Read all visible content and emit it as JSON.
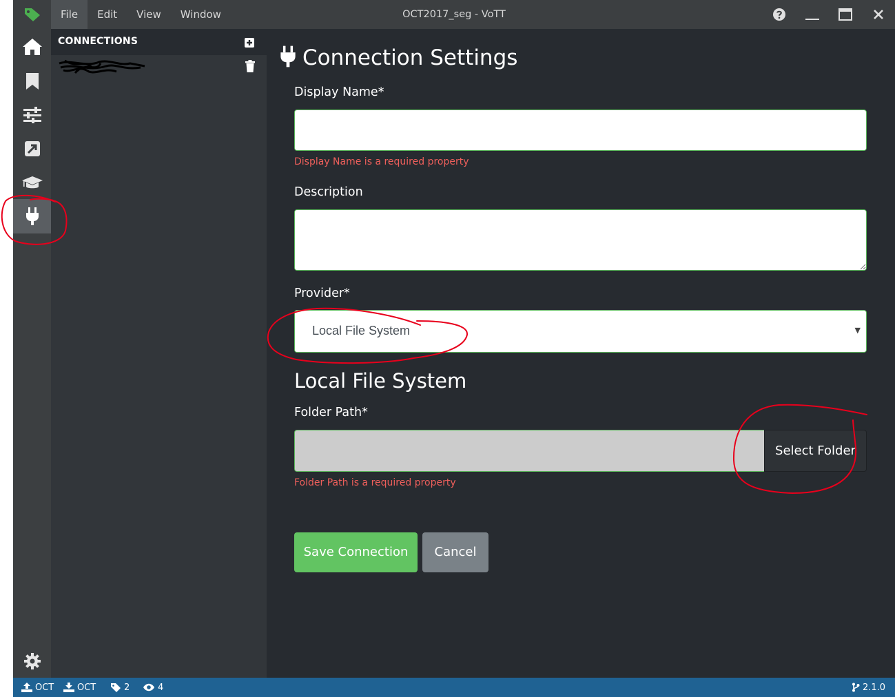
{
  "window": {
    "title": "OCT2017_seg - VoTT"
  },
  "menu": [
    {
      "label": "File",
      "active": true
    },
    {
      "label": "Edit",
      "active": false
    },
    {
      "label": "View",
      "active": false
    },
    {
      "label": "Window",
      "active": false
    }
  ],
  "iconbar": {
    "items": [
      "home-icon",
      "bookmark-icon",
      "sliders-icon",
      "export-icon",
      "graduation-cap-icon",
      "plug-icon"
    ],
    "active": "plug-icon",
    "bottom": "gear-icon"
  },
  "sidebar": {
    "title": "CONNECTIONS"
  },
  "form": {
    "title": "Connection Settings",
    "display_name_label": "Display Name*",
    "display_name_value": "",
    "display_name_error": "Display Name is a required property",
    "description_label": "Description",
    "description_value": "",
    "provider_label": "Provider*",
    "provider_value": "Local File System",
    "section_title": "Local File System",
    "folder_path_label": "Folder Path*",
    "folder_path_value": "",
    "select_folder_label": "Select Folder",
    "folder_path_error": "Folder Path is a required property",
    "save_label": "Save Connection",
    "cancel_label": "Cancel"
  },
  "statusbar": {
    "source": "OCT",
    "target": "OCT",
    "tags": "2",
    "visited": "4",
    "version": "2.1.0"
  },
  "colors": {
    "accent_green": "#62c462",
    "error_red": "#ee5f5b",
    "statusbar_blue": "#1f6293",
    "annotation_red": "#e8001c"
  }
}
